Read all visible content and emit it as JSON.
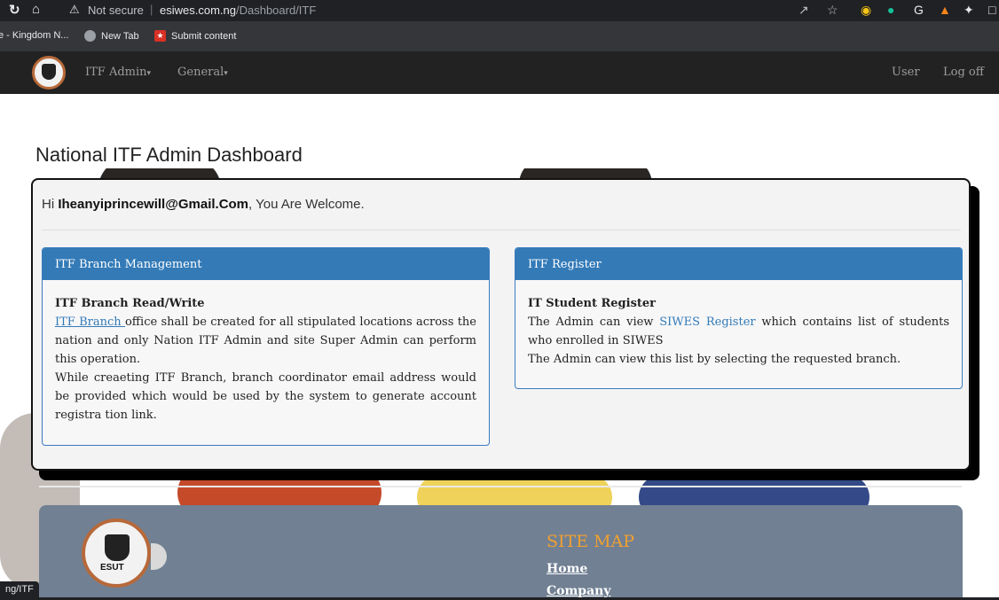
{
  "browser": {
    "not_secure": "Not secure",
    "url_host": "esiwes.com.ng",
    "url_path": "/Dashboard/ITF",
    "bookmarks": [
      "e - Kingdom N...",
      "New Tab",
      "Submit content"
    ],
    "status_url": "ng/ITF"
  },
  "navbar": {
    "menu_itf_admin": "ITF Admin",
    "menu_general": "General",
    "user": "User",
    "logoff": "Log off"
  },
  "page": {
    "title": "National ITF Admin Dashboard"
  },
  "welcome": {
    "prefix": "Hi ",
    "email": "Iheanyiprincewill@Gmail.Com",
    "suffix": ", You Are Welcome."
  },
  "panels": [
    {
      "heading": "ITF Branch Management",
      "subtitle": "ITF Branch Read/Write",
      "link": "ITF Branch ",
      "text1": "office shall be created for all stipulated locations across the nation and only Nation ITF Admin and site Super Admin can perform this operation.",
      "text2": "While creaeting ITF Branch, branch coordinator email address would be provided which would be used by the system to generate account registra tion link."
    },
    {
      "heading": "ITF Register",
      "subtitle": "IT Student Register",
      "text_pre": "The Admin can view ",
      "link": "SIWES Register",
      "text_post": " which contains list of students who enrolled in SIWES",
      "text2": "The Admin can view this list by selecting the requested branch."
    }
  ],
  "footer": {
    "logo_text": "ESUT",
    "sitemap_title": "SITE MAP",
    "links": [
      "Home",
      "Company"
    ]
  },
  "colors": {
    "navbar": "#222222",
    "panel_header": "#337ab7",
    "footer": "#718093",
    "sitemap_title": "#f0a030"
  }
}
